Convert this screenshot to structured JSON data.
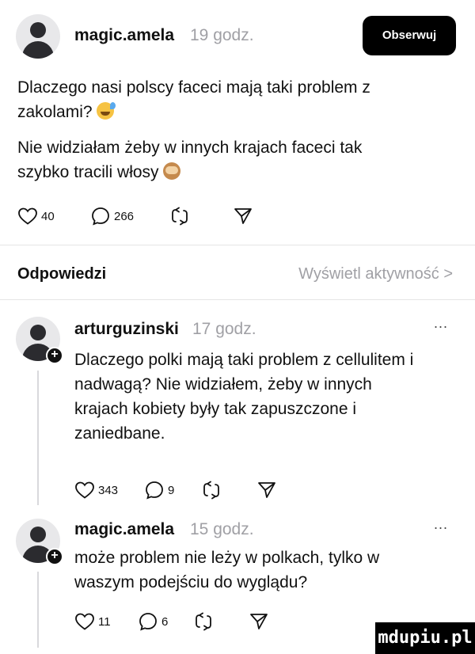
{
  "post": {
    "username": "magic.amela",
    "time": "19 godz.",
    "follow_label": "Obserwuj",
    "line1": "Dlaczego nasi polscy faceci mają taki problem z",
    "line2": "zakolami?",
    "line3": "Nie widziałam żeby w innych krajach faceci tak",
    "line4": "szybko tracili włosy",
    "likes": "40",
    "comments": "266"
  },
  "replies_header": {
    "title": "Odpowiedzi",
    "activity_link": "Wyświetl aktywność >"
  },
  "replies": [
    {
      "username": "arturguzinski",
      "time": "17 godz.",
      "more": "...",
      "lines": [
        "Dlaczego polki mają taki problem z cellulitem i",
        "nadwagą? Nie widziałem, żeby w innych",
        "krajach kobiety były tak zapuszczone i",
        "zaniedbane."
      ],
      "likes": "343",
      "comments": "9"
    },
    {
      "username": "magic.amela",
      "time": "15 godz.",
      "more": "...",
      "lines": [
        "może problem nie leży w polkach, tylko w",
        "waszym podejściu do wyglądu?"
      ],
      "likes": "11",
      "comments": "6"
    }
  ],
  "watermark": "mdupiu.pl",
  "icons": {
    "like": "heart-icon",
    "comment": "comment-icon",
    "repost": "repost-icon",
    "share": "send-icon",
    "avatar": "user-avatar-icon"
  }
}
